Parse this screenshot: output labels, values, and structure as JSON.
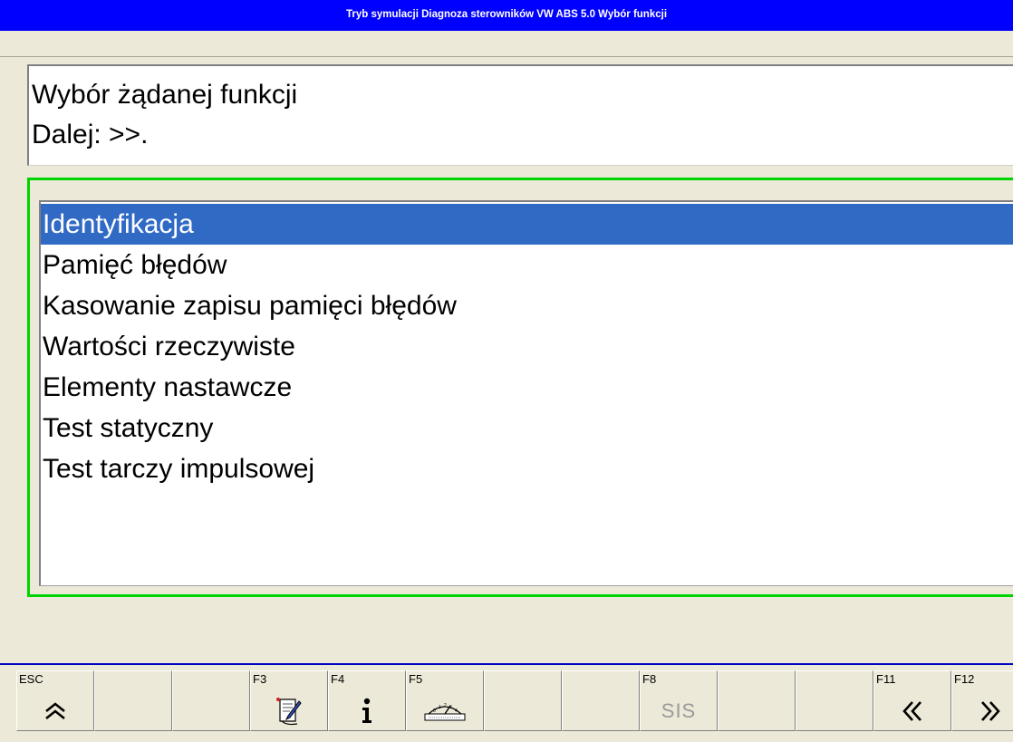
{
  "window": {
    "title": "Tryb symulacji Diagnoza sterowników  VW  ABS 5.0  Wybór funkcji"
  },
  "message": {
    "lines": [
      "Wybór żądanej funkcji",
      "Dalej: >>."
    ]
  },
  "function_list": {
    "selected_index": 0,
    "items": [
      "Identyfikacja",
      "Pamięć błędów",
      "Kasowanie zapisu pamięci błędów",
      "Wartości rzeczywiste",
      "Elementy nastawcze",
      "Test statyczny",
      "Test tarczy impulsowej"
    ]
  },
  "function_keys": [
    {
      "label": "ESC",
      "icon": "double-chevron-up-icon"
    },
    {
      "label": "",
      "icon": ""
    },
    {
      "label": "",
      "icon": ""
    },
    {
      "label": "F3",
      "icon": "notepad-pencil-icon"
    },
    {
      "label": "F4",
      "icon": "info-icon"
    },
    {
      "label": "F5",
      "icon": "gauge-icon"
    },
    {
      "label": "",
      "icon": ""
    },
    {
      "label": "",
      "icon": ""
    },
    {
      "label": "F8",
      "icon": "sis-text-icon",
      "text": "SIS"
    },
    {
      "label": "",
      "icon": ""
    },
    {
      "label": "",
      "icon": ""
    },
    {
      "label": "F11",
      "icon": "double-chevron-left-icon"
    },
    {
      "label": "F12",
      "icon": "double-chevron-right-icon"
    }
  ],
  "colors": {
    "titlebar": "#0000fe",
    "selection": "#316ac5",
    "focus_border": "#00d400",
    "background": "#ece9d8"
  }
}
